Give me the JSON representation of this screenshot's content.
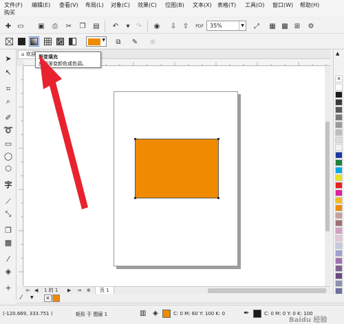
{
  "menu": {
    "items": [
      "文件(F)",
      "编辑(E)",
      "查看(V)",
      "布局(L)",
      "对象(C)",
      "效果(C)",
      "位图(B)",
      "文本(X)",
      "表格(T)",
      "工具(O)",
      "窗口(W)",
      "帮助(H)"
    ],
    "second_row": "购买"
  },
  "toolbar": {
    "zoom_value": "35%",
    "pdf_label": "PDF"
  },
  "tabs": {
    "home_label": "欢迎"
  },
  "tooltip": {
    "title": "渐变填充",
    "description": "应用渐变颜色或色调。"
  },
  "page_nav": {
    "counter": "1 的 1",
    "page_tab": "页 1"
  },
  "colors": {
    "accent_orange": "#f08a00",
    "arrow_red": "#e8232f",
    "palette": [
      "#ffffff",
      "#1a1a1a",
      "#3a3a3a",
      "#5a5a5a",
      "#7a7a7a",
      "#9a9a9a",
      "#bcbcbc",
      "#dcdcdc",
      "#f2f2f2",
      "#1a3aa0",
      "#1c7f3a",
      "#00a8e0",
      "#e8e020",
      "#e82020",
      "#e020a0",
      "#f0c020",
      "#f08a00",
      "#c8a0a0",
      "#a07070",
      "#d0a0c0",
      "#e0c8d8",
      "#c8c8e0",
      "#a0a0d0",
      "#a070b0",
      "#806090",
      "#6a4a80",
      "#9090b0",
      "#7070a0"
    ]
  },
  "status": {
    "coords": "(-120.669, 333.751 )",
    "object_info": "矩形 于 图层 1",
    "fill_cmyk": "C: 0 M: 60 Y: 100 K: 0",
    "outline_cmyk": "C: 0 M: 0 Y: 0 K: 100",
    "watermark": "Baidu 经验"
  }
}
